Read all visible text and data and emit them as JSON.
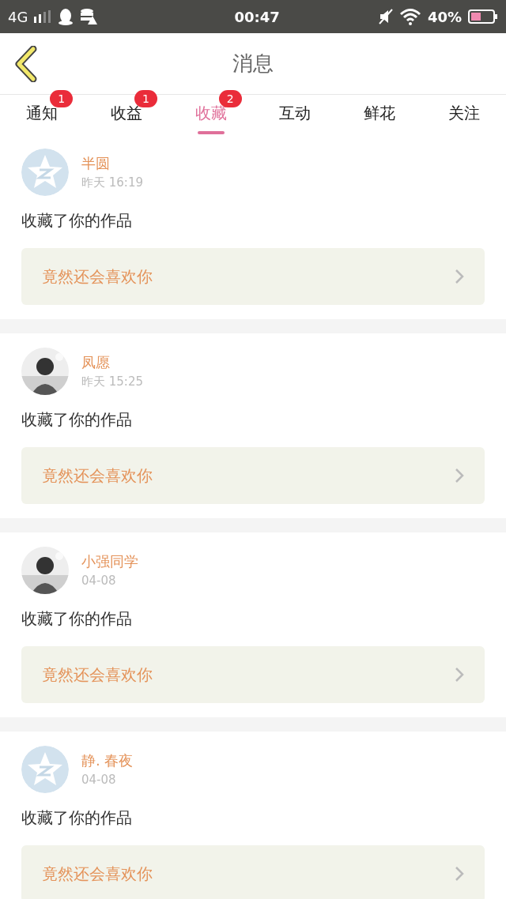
{
  "status_bar": {
    "network": "4G",
    "time": "00:47",
    "battery": "40%"
  },
  "header": {
    "title": "消息"
  },
  "tabs": [
    {
      "label": "通知",
      "badge": "1",
      "selected": false
    },
    {
      "label": "收益",
      "badge": "1",
      "selected": false
    },
    {
      "label": "收藏",
      "badge": "2",
      "selected": true
    },
    {
      "label": "互动",
      "selected": false
    },
    {
      "label": "鲜花",
      "selected": false
    },
    {
      "label": "关注",
      "selected": false
    }
  ],
  "messages": [
    {
      "avatar": {
        "kind": "default"
      },
      "name": "半圆",
      "time": "昨天 16:19",
      "text": "收藏了你的作品",
      "work": "竟然还会喜欢你"
    },
    {
      "name": "凤愿",
      "time": "昨天 15:25",
      "text": "收藏了你的作品",
      "work": "竟然还会喜欢你"
    },
    {
      "name": "小强同学",
      "time": "04-08",
      "text": "收藏了你的作品",
      "work": "竟然还会喜欢你"
    },
    {
      "avatar": {
        "kind": "default"
      },
      "name": "静. 春夜",
      "time": "04-08",
      "text": "收藏了你的作品",
      "work": "竟然还会喜欢你"
    }
  ]
}
